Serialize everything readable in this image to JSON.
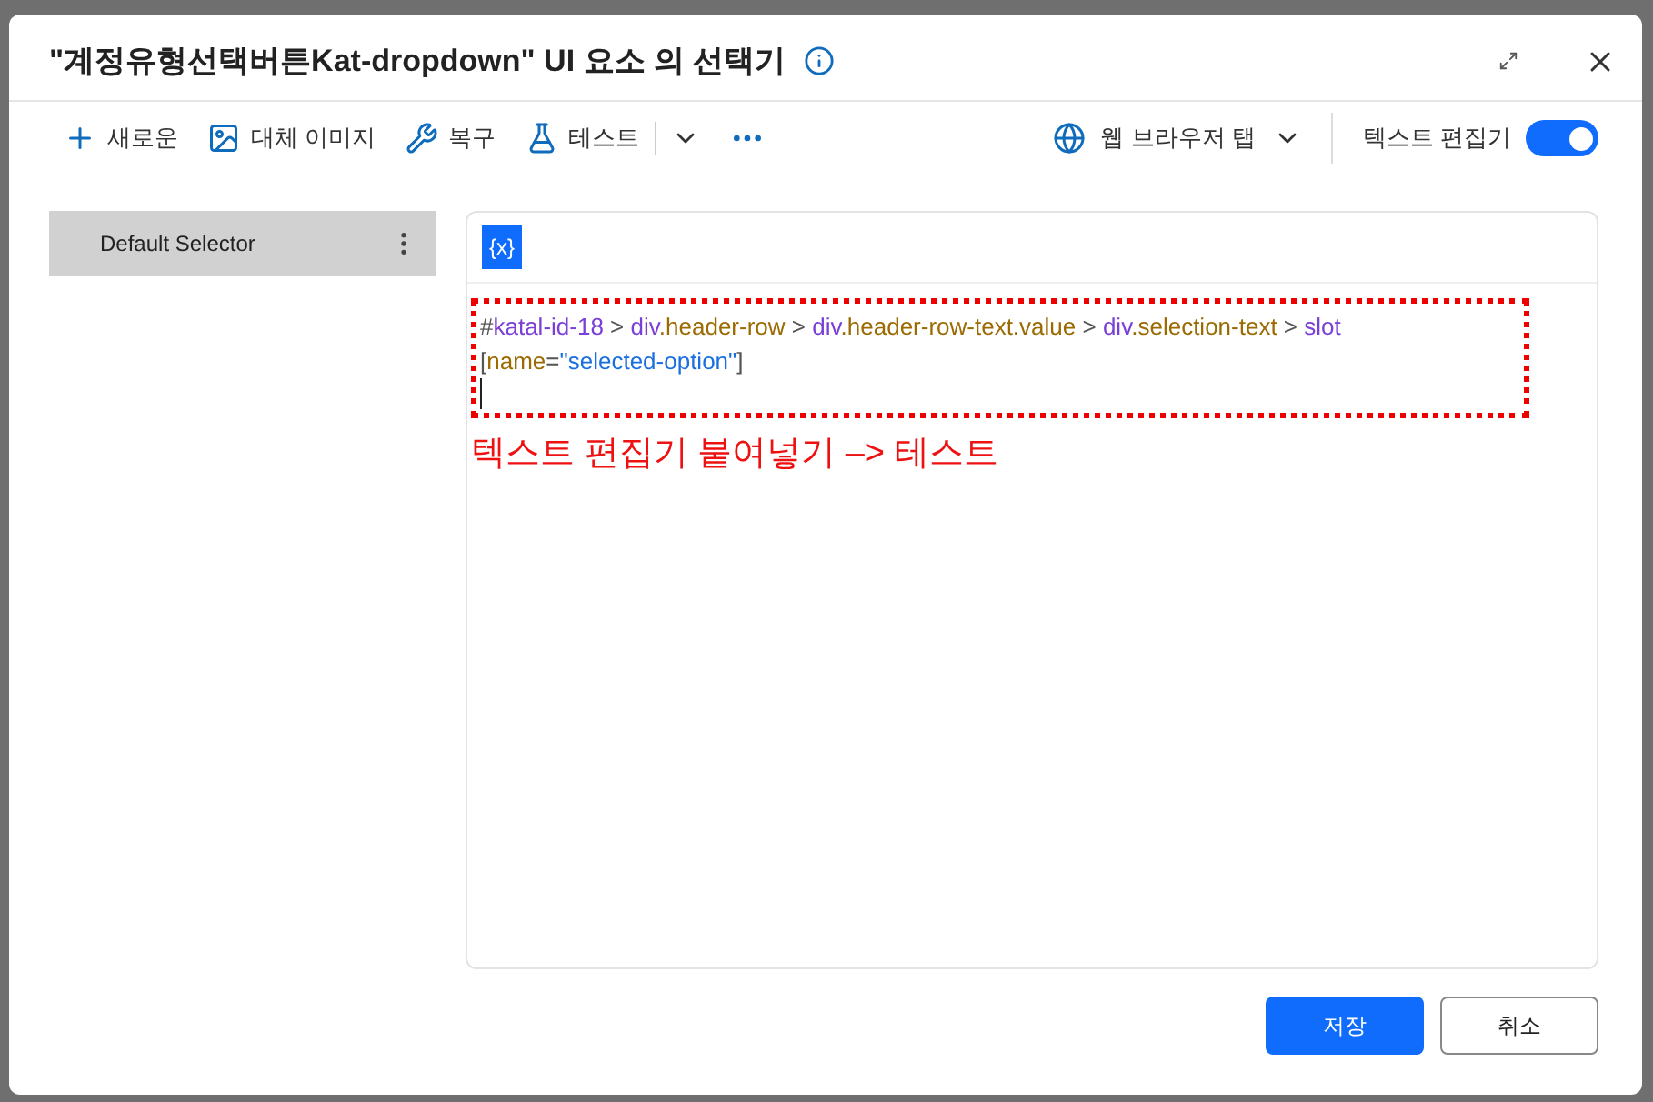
{
  "dialog": {
    "title": "\"계정유형선택버튼Kat-dropdown\" UI 요소 의 선택기"
  },
  "toolbar": {
    "items": [
      {
        "kind": "new",
        "label": "새로운"
      },
      {
        "kind": "image",
        "label": "대체 이미지"
      },
      {
        "kind": "repair",
        "label": "복구"
      },
      {
        "kind": "test",
        "label": "테스트"
      }
    ],
    "target": "웹 브라우저 탭",
    "text_editor": {
      "label": "텍스트 편집기",
      "on": true
    }
  },
  "selectors": [
    {
      "label": "Default Selector",
      "selected": true
    }
  ],
  "editor": {
    "variable_button": "{x}",
    "lines": [
      [
        {
          "kind": "punct",
          "text": "#"
        },
        {
          "kind": "tag",
          "text": "katal-id-18"
        },
        {
          "kind": "punct",
          "text": " > "
        },
        {
          "kind": "tag",
          "text": "div"
        },
        {
          "kind": "cls",
          "text": ".header-row"
        },
        {
          "kind": "punct",
          "text": " > "
        },
        {
          "kind": "tag",
          "text": "div"
        },
        {
          "kind": "cls",
          "text": ".header-row-text.value"
        },
        {
          "kind": "punct",
          "text": " > "
        },
        {
          "kind": "tag",
          "text": "div"
        },
        {
          "kind": "cls",
          "text": ".selection-text"
        },
        {
          "kind": "punct",
          "text": " > "
        },
        {
          "kind": "tag",
          "text": "slot"
        }
      ],
      [
        {
          "kind": "punct",
          "text": "["
        },
        {
          "kind": "cls",
          "text": "name"
        },
        {
          "kind": "punct",
          "text": "="
        },
        {
          "kind": "str",
          "text": "\"selected-option\""
        },
        {
          "kind": "punct",
          "text": "]"
        }
      ]
    ],
    "annotation": "텍스트 편집기 붙여넣기 –> 테스트"
  },
  "buttons": [
    {
      "label": "저장",
      "kind": "primary"
    },
    {
      "label": "취소",
      "kind": "secondary"
    }
  ]
}
